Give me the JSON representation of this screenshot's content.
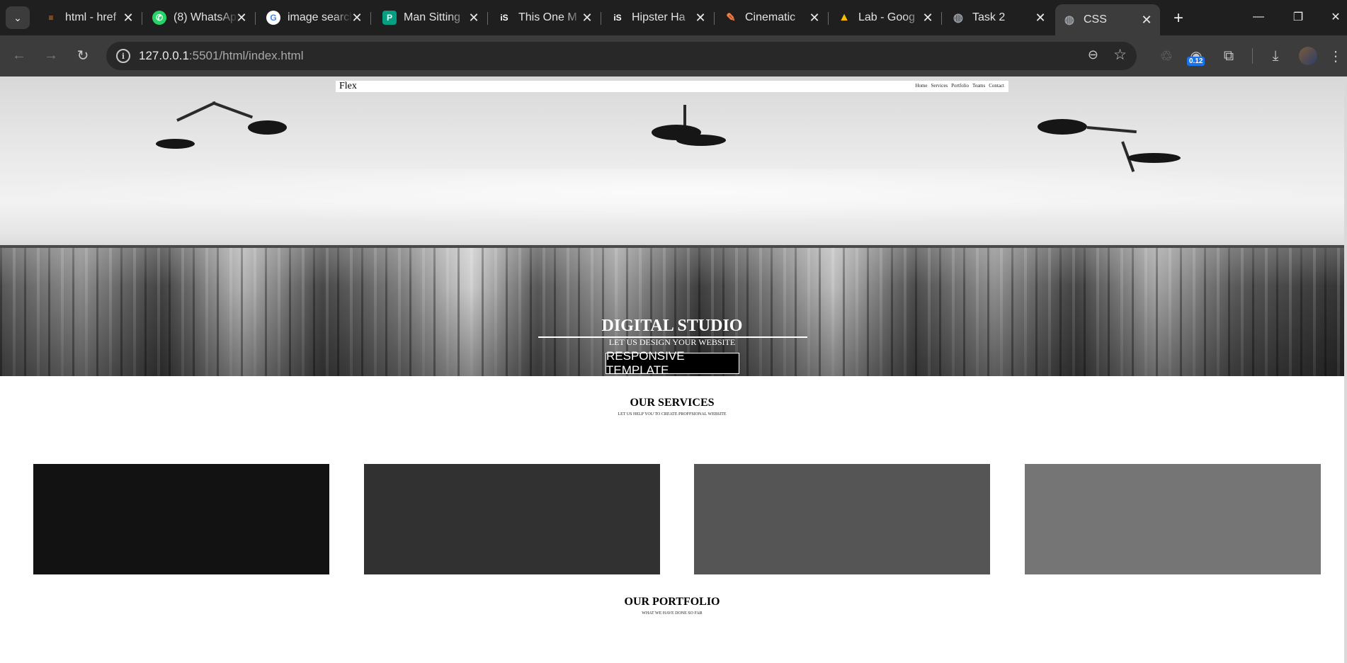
{
  "browser": {
    "tabs": [
      {
        "title": "html - href",
        "icon": "stackoverflow-icon",
        "color": "#f48024"
      },
      {
        "title": "(8) WhatsApp",
        "icon": "whatsapp-icon",
        "color": "#25d366"
      },
      {
        "title": "image search",
        "icon": "google-icon",
        "color": "#ffffff"
      },
      {
        "title": "Man Sitting",
        "icon": "pexels-icon",
        "color": "#05a081"
      },
      {
        "title": "This One M",
        "icon": "istock-icon",
        "color": "#ffffff"
      },
      {
        "title": "Hipster Ha",
        "icon": "istock-icon",
        "color": "#ffffff"
      },
      {
        "title": "Cinematic",
        "icon": "pencil-icon",
        "color": "#ff7a3d"
      },
      {
        "title": "Lab - Goog",
        "icon": "google-drive-icon",
        "color": "#fbbc04"
      },
      {
        "title": "Task 2",
        "icon": "globe-icon",
        "color": "#9aa0a6"
      },
      {
        "title": "CSS",
        "icon": "globe-icon",
        "color": "#9aa0a6",
        "active": true
      }
    ],
    "address": {
      "host": "127.0.0.1",
      "rest": ":5501/html/index.html"
    },
    "extension_badge": "0.12"
  },
  "page": {
    "nav": {
      "brand": "Flex",
      "links": [
        "Home",
        "Services",
        "Portfolio",
        "Teams",
        "Contact"
      ]
    },
    "hero": {
      "title": "DIGITAL STUDIO",
      "subtitle": "LET US DESIGN YOUR WEBSITE",
      "button": "RESPONSIVE TEMPLATE"
    },
    "services": {
      "title": "OUR SERVICES",
      "subtitle": "LET US HELP YOU TO CREATE PROFFSIONAL WEBSITE",
      "cards": [
        {
          "color": "#121212"
        },
        {
          "color": "#313131"
        },
        {
          "color": "#555555"
        },
        {
          "color": "#757575"
        }
      ]
    },
    "portfolio": {
      "title": "OUR PORTFOLIO",
      "subtitle": "WHAT WE HAVE DONE SO FAR"
    }
  }
}
